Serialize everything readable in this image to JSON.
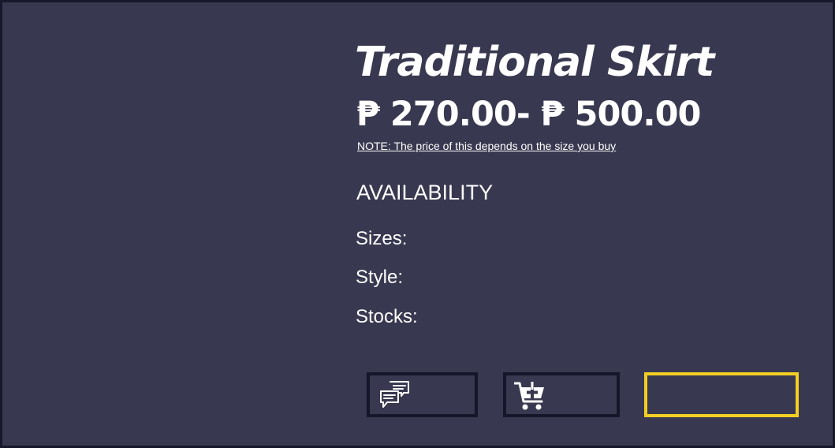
{
  "product": {
    "title": "Traditional Skirt",
    "price_range": "₱ 270.00- ₱ 500.00",
    "note": "NOTE: The price of this depends on the size you buy"
  },
  "availability": {
    "heading": "AVAILABILITY",
    "sizes_label": "Sizes:",
    "style_label": "Style:",
    "stocks_label": "Stocks:"
  },
  "actions": {
    "chat_icon": "chat-bubbles-icon",
    "cart_icon": "add-to-cart-icon",
    "buy_accent": "#f3ce22"
  },
  "colors": {
    "background": "#383950",
    "border": "#14162a",
    "text": "#ffffff",
    "accent": "#f3ce22"
  }
}
